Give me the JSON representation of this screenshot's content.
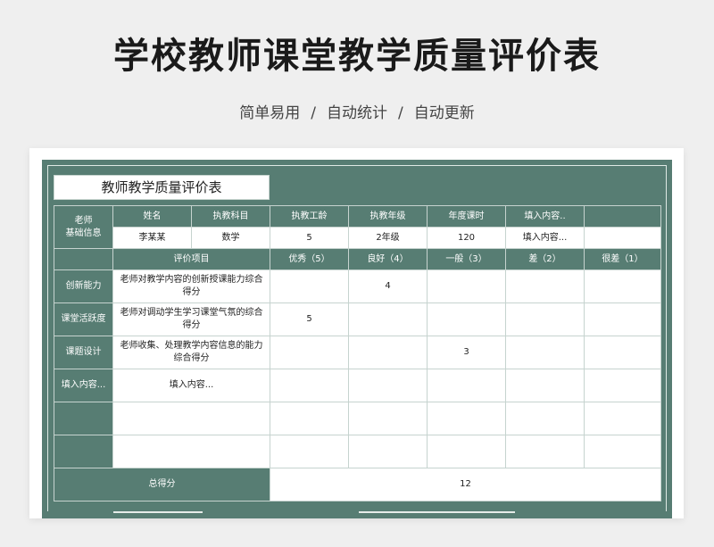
{
  "header": {
    "title": "学校教师课堂教学质量评价表",
    "subtitle_parts": [
      "简单易用",
      "自动统计",
      "自动更新"
    ],
    "separator": "/"
  },
  "sheet": {
    "title": "教师教学质量评价表",
    "colors": {
      "green": "#577d73",
      "white": "#ffffff"
    },
    "teacher_section": {
      "label": "老师\n基础信息",
      "headers": [
        "姓名",
        "执教科目",
        "执教工龄",
        "执教年级",
        "年度课时",
        "填入内容.."
      ],
      "values": [
        "李某某",
        "数学",
        "5",
        "2年级",
        "120",
        "填入内容..."
      ]
    },
    "eval_headers": {
      "item": "评价项目",
      "levels": [
        "优秀（5）",
        "良好（4）",
        "一般（3）",
        "差（2）",
        "很差（1）"
      ]
    },
    "rows": [
      {
        "category": "创新能力",
        "item": "老师对教学内容的创新授课能力综合得分",
        "scores": [
          "",
          "4",
          "",
          "",
          ""
        ]
      },
      {
        "category": "课堂活跃度",
        "item": "老师对调动学生学习课堂气氛的综合得分",
        "scores": [
          "5",
          "",
          "",
          "",
          ""
        ]
      },
      {
        "category": "课题设计",
        "item": "老师收集、处理教学内容信息的能力综合得分",
        "scores": [
          "",
          "",
          "3",
          "",
          ""
        ]
      },
      {
        "category": "填入内容...",
        "item": "填入内容...",
        "scores": [
          "",
          "",
          "",
          "",
          ""
        ]
      },
      {
        "category": "",
        "item": "",
        "scores": [
          "",
          "",
          "",
          "",
          ""
        ]
      },
      {
        "category": "",
        "item": "",
        "scores": [
          "",
          "",
          "",
          "",
          ""
        ]
      }
    ],
    "total": {
      "label": "总得分",
      "value": "12"
    }
  }
}
